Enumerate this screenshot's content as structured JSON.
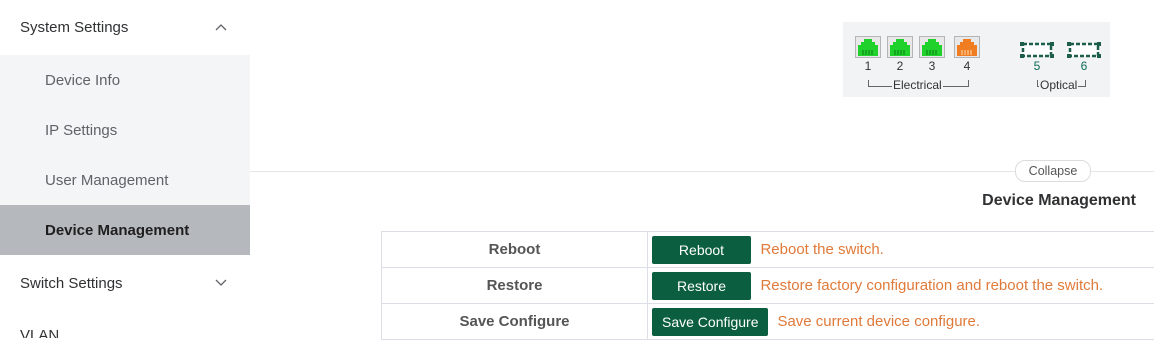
{
  "sidebar": {
    "system_settings": {
      "label": "System Settings",
      "expanded": true,
      "icon": "chevron-up-icon"
    },
    "items": [
      {
        "label": "Device Info",
        "active": false
      },
      {
        "label": "IP Settings",
        "active": false
      },
      {
        "label": "User Management",
        "active": false
      },
      {
        "label": "Device Management",
        "active": true
      }
    ],
    "switch_settings": {
      "label": "Switch Settings",
      "expanded": false,
      "icon": "chevron-down-icon"
    },
    "vlan": {
      "label": "VLAN"
    }
  },
  "ports": {
    "electrical": [
      {
        "num": "1",
        "status": "link-up",
        "color": "#1fd12a"
      },
      {
        "num": "2",
        "status": "link-up",
        "color": "#1fd12a"
      },
      {
        "num": "3",
        "status": "link-up",
        "color": "#1fd12a"
      },
      {
        "num": "4",
        "status": "alert",
        "color": "#f07d22"
      }
    ],
    "optical": [
      {
        "num": "5",
        "status": "down"
      },
      {
        "num": "6",
        "status": "down"
      }
    ],
    "electrical_label": "Electrical",
    "optical_label": "Optical"
  },
  "collapse_label": "Collapse",
  "main": {
    "title": "Device Management",
    "rows": [
      {
        "label": "Reboot",
        "button": "Reboot",
        "desc": "Reboot the switch."
      },
      {
        "label": "Restore",
        "button": "Restore",
        "desc": "Restore factory configuration and reboot the switch."
      },
      {
        "label": "Save Configure",
        "button": "Save Configure",
        "desc": "Save current device configure."
      }
    ]
  },
  "colors": {
    "accent_button": "#0b5e3f",
    "description_text": "#e07a3a",
    "active_sidebar_bg": "#b5b8bd",
    "port_up": "#1fd12a",
    "port_alert": "#f07d22",
    "optical_port": "#1d5e4a"
  }
}
